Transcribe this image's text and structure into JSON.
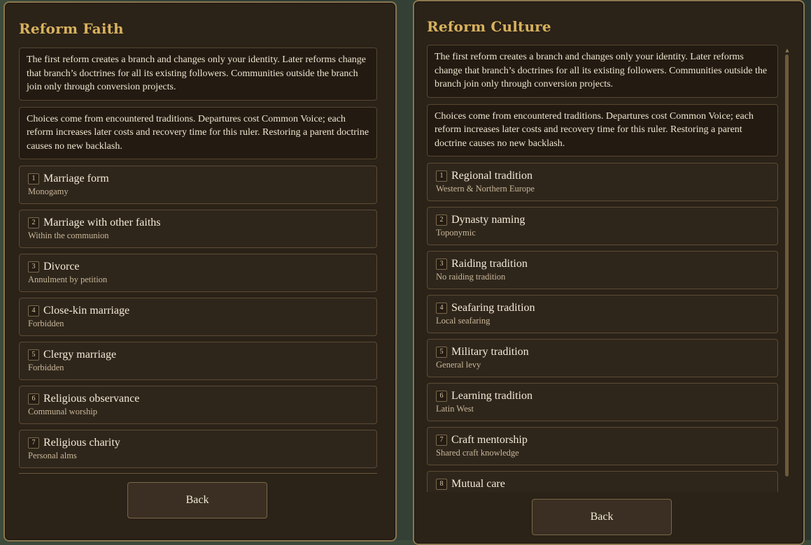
{
  "faith": {
    "title": "Reform Faith",
    "info": [
      "The first reform creates a branch and changes only your identity. Later reforms change that branch’s doctrines for all its existing followers. Communities outside the branch join only through conversion projects.",
      "Choices come from encountered traditions. Departures cost Common Voice; each reform increases later costs and recovery time for this ruler. Restoring a parent doctrine causes no new backlash."
    ],
    "options": [
      {
        "num": "1",
        "title": "Marriage form",
        "value": "Monogamy"
      },
      {
        "num": "2",
        "title": "Marriage with other faiths",
        "value": "Within the communion"
      },
      {
        "num": "3",
        "title": "Divorce",
        "value": "Annulment by petition"
      },
      {
        "num": "4",
        "title": "Close-kin marriage",
        "value": "Forbidden"
      },
      {
        "num": "5",
        "title": "Clergy marriage",
        "value": "Forbidden"
      },
      {
        "num": "6",
        "title": "Religious observance",
        "value": "Communal worship"
      },
      {
        "num": "7",
        "title": "Religious charity",
        "value": "Personal alms"
      }
    ],
    "back_label": "Back"
  },
  "culture": {
    "title": "Reform Culture",
    "info": [
      "The first reform creates a branch and changes only your identity. Later reforms change that branch’s doctrines for all its existing followers. Communities outside the branch join only through conversion projects.",
      "Choices come from encountered traditions. Departures cost Common Voice; each reform increases later costs and recovery time for this ruler. Restoring a parent doctrine causes no new backlash."
    ],
    "options": [
      {
        "num": "1",
        "title": "Regional tradition",
        "value": "Western & Northern Europe"
      },
      {
        "num": "2",
        "title": "Dynasty naming",
        "value": "Toponymic"
      },
      {
        "num": "3",
        "title": "Raiding tradition",
        "value": "No raiding tradition"
      },
      {
        "num": "4",
        "title": "Seafaring tradition",
        "value": "Local seafaring"
      },
      {
        "num": "5",
        "title": "Military tradition",
        "value": "General levy"
      },
      {
        "num": "6",
        "title": "Learning tradition",
        "value": "Latin West"
      },
      {
        "num": "7",
        "title": "Craft mentorship",
        "value": "Shared craft knowledge"
      },
      {
        "num": "8",
        "title": "Mutual care",
        "value": ""
      }
    ],
    "back_label": "Back",
    "scroll_up_icon": "▲",
    "scroll_down_icon": "▼"
  }
}
